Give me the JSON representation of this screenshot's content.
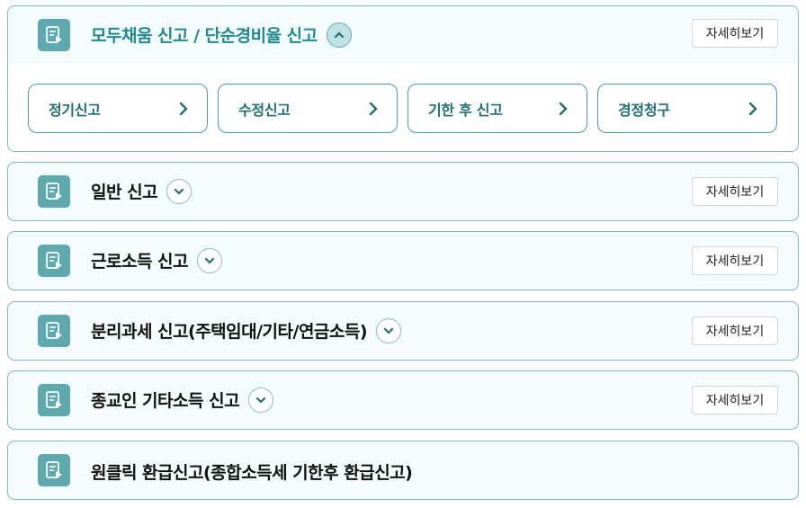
{
  "sections": [
    {
      "title": "모두채움 신고 / 단순경비율 신고",
      "detail_label": "자세히보기",
      "expanded": true,
      "sub_items": [
        "정기신고",
        "수정신고",
        "기한 후 신고",
        "경정청구"
      ]
    },
    {
      "title": "일반 신고",
      "detail_label": "자세히보기"
    },
    {
      "title": "근로소득 신고",
      "detail_label": "자세히보기"
    },
    {
      "title": "분리과세 신고(주택임대/기타/연금소득)",
      "detail_label": "자세히보기"
    },
    {
      "title": "종교인 기타소득 신고",
      "detail_label": "자세히보기"
    },
    {
      "title": "원클릭 환급신고(종합소득세 기한후 환급신고)"
    }
  ],
  "icons": {
    "section_icon": "document-report-icon",
    "expand_open": "chevron-up-icon",
    "expand_closed": "chevron-down-icon",
    "sub_arrow": "chevron-right-icon"
  },
  "colors": {
    "accent": "#1f8a8f",
    "icon_bg": "#5ea9ad",
    "panel_bg": "#f3fbfb",
    "border": "#7fb9bb"
  }
}
